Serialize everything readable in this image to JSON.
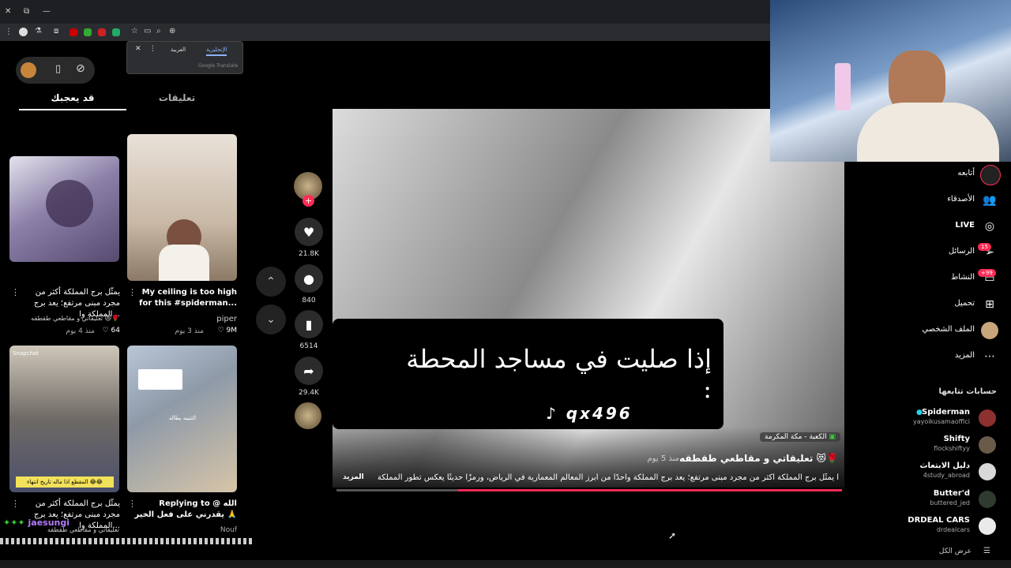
{
  "browser": {
    "window_controls": [
      "✕",
      "⧉",
      "—"
    ],
    "translate_popup": {
      "lang_arabic": "العربية",
      "lang_english": "الإنجليزية",
      "powered": "Google Translate"
    }
  },
  "left_panel": {
    "tabs": {
      "comments": "تعليقات",
      "you_may_like": "قد يعجبك"
    },
    "videos": [
      {
        "caption": "يمثّل برج المملكة أكثر من مجرد مبنى مرتفع؛ يعد برج المملكة وا...",
        "author": "تعليقاتي و مقاطعي طقطقه 😻🌹",
        "meta": "منذ 4 يوم",
        "likes": "64"
      },
      {
        "caption": "My ceiling is too high for this #spiderman...",
        "author": "piper",
        "meta": "منذ 3 يوم",
        "likes": "9M"
      },
      {
        "caption": "يمثّل برج المملكة أكثر من مجرد مبنى مرتفع؛ يعد برج المملكة وا...",
        "author": "تعليقاتي و مقاطعي طقطقه",
        "overlay_text": "المقطع اذا ماله تاريخ انتهاء 😂😂",
        "snapchat": "Snapchat"
      },
      {
        "caption": "Replying to @ الله يقدرني على فعل الخير 🙏",
        "author": "Nouf",
        "overlay_text": "التنبيه بطاله"
      }
    ],
    "chat": {
      "username": "jaesungi"
    }
  },
  "center": {
    "overlay_text": "إذا صليت في مساجد المحطة :",
    "watermark": "qx496",
    "location": "الكعبة - مكة المكرمة",
    "author": "تعليقاتي و مقاطعي طقطقه 😻🌹",
    "time": "منذ 5 يوم",
    "description": "ا يمثّل برج المملكة أكثر من مجرد مبنى مرتفع؛ يعد برج المملكة واحدًا من أبرز المعالم المعمارية في الرياض، ورمزًا حديثًا يعكس تطور المملكة",
    "more": "المزيد",
    "actions": {
      "likes": "21.8K",
      "comments": "840",
      "saves": "6514",
      "shares": "29.4K"
    }
  },
  "right_nav": {
    "items": [
      {
        "label": "أتابعه",
        "icon": "◉"
      },
      {
        "label": "الأصدقاء",
        "icon": "👥"
      },
      {
        "label": "LIVE",
        "icon": "◎"
      },
      {
        "label": "الرسائل",
        "icon": "➢",
        "badge": "15"
      },
      {
        "label": "النشاط",
        "icon": "▭",
        "badge": "+99"
      },
      {
        "label": "تحميل",
        "icon": "⊞"
      },
      {
        "label": "الملف الشخصي",
        "icon": "◯"
      },
      {
        "label": "المزيد",
        "icon": "⋯"
      }
    ],
    "following_title": "حسابات تتابعها",
    "accounts": [
      {
        "name": "Spiderman",
        "handle": "yayoikusamaoffici",
        "color": "#8c3030"
      },
      {
        "name": "Shifty",
        "handle": "flockshiftyy",
        "color": "#6a5a4a"
      },
      {
        "name": "دليل الابتعاث",
        "handle": "4study_abroad",
        "color": "#d8d8d8"
      },
      {
        "name": "Butter'd",
        "handle": "buttered_jed",
        "color": "#2f3b2f"
      },
      {
        "name": "DRDEAL CARS",
        "handle": "drdealcars",
        "color": "#eaeaea"
      }
    ],
    "see_all": "عرض الكل"
  },
  "colors": {
    "accent": "#fe2c55",
    "bg": "#000000",
    "panel": "#1e1f22"
  }
}
